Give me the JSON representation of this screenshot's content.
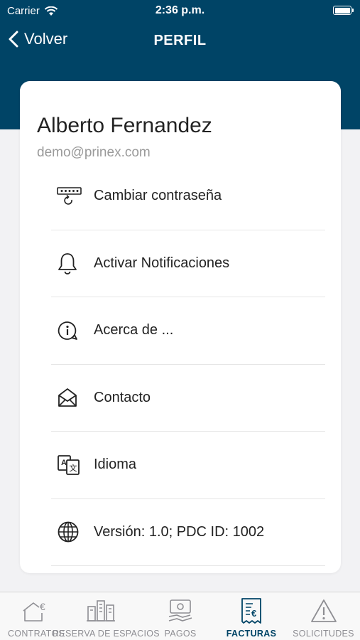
{
  "status_bar": {
    "carrier": "Carrier",
    "time": "2:36 p.m."
  },
  "nav": {
    "back_label": "Volver",
    "title": "PERFIL"
  },
  "profile": {
    "name": "Alberto Fernandez",
    "email": "demo@prinex.com"
  },
  "menu": [
    {
      "label": "Cambiar contraseña",
      "icon": "password-icon"
    },
    {
      "label": "Activar Notificaciones",
      "icon": "bell-icon"
    },
    {
      "label": "Acerca de ...",
      "icon": "info-icon"
    },
    {
      "label": "Contacto",
      "icon": "envelope-icon"
    },
    {
      "label": "Idioma",
      "icon": "language-icon"
    },
    {
      "label": "Versión: 1.0; PDC ID: 1002",
      "icon": "globe-icon"
    }
  ],
  "tabs": [
    {
      "label": "CONTRATOS",
      "icon": "house-euro-icon",
      "active": false
    },
    {
      "label": "RESERVA DE ESPACIOS",
      "icon": "building-icon",
      "active": false
    },
    {
      "label": "PAGOS",
      "icon": "payment-icon",
      "active": false
    },
    {
      "label": "FACTURAS",
      "icon": "invoice-icon",
      "active": true
    },
    {
      "label": "SOLICITUDES",
      "icon": "warning-icon",
      "active": false
    }
  ],
  "colors": {
    "header": "#004466",
    "active_tab": "#004466",
    "inactive_tab": "#8e8e93"
  }
}
